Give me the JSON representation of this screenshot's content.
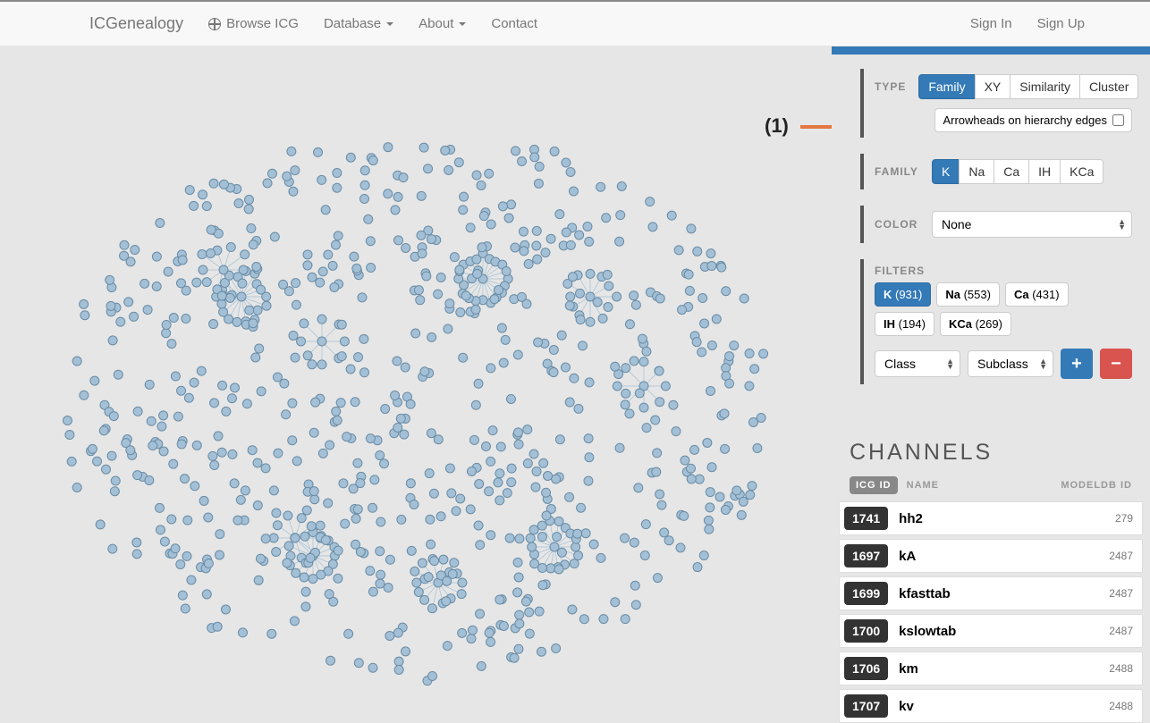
{
  "nav": {
    "brand": "ICGenealogy",
    "browse": "Browse ICG",
    "database": "Database",
    "about": "About",
    "contact": "Contact",
    "signin": "Sign In",
    "signup": "Sign Up"
  },
  "help_glyph": "?",
  "annotation": {
    "label": "(1)"
  },
  "sidebar": {
    "type": {
      "label": "TYPE",
      "options": {
        "family": "Family",
        "xy": "XY",
        "similarity": "Similarity",
        "cluster": "Cluster"
      },
      "arrowheads_label": "Arrowheads on hierarchy edges"
    },
    "family": {
      "label": "FAMILY",
      "options": {
        "k": "K",
        "na": "Na",
        "ca": "Ca",
        "ih": "IH",
        "kca": "KCa"
      }
    },
    "color": {
      "label": "COLOR",
      "value": "None"
    },
    "filters": {
      "label": "FILTERS",
      "tags": [
        {
          "name": "K",
          "count": "(931)",
          "active": true
        },
        {
          "name": "Na",
          "count": "(553)",
          "active": false
        },
        {
          "name": "Ca",
          "count": "(431)",
          "active": false
        },
        {
          "name": "IH",
          "count": "(194)",
          "active": false
        },
        {
          "name": "KCa",
          "count": "(269)",
          "active": false
        }
      ],
      "class_select": "Class",
      "subclass_select": "Subclass",
      "plus": "+",
      "minus": "−"
    },
    "channels": {
      "header": "CHANNELS",
      "col_icg": "ICG ID",
      "col_name": "NAME",
      "col_mdb": "MODELDB ID",
      "rows": [
        {
          "id": "1741",
          "name": "hh2",
          "mdb": "279"
        },
        {
          "id": "1697",
          "name": "kA",
          "mdb": "2487"
        },
        {
          "id": "1699",
          "name": "kfasttab",
          "mdb": "2487"
        },
        {
          "id": "1700",
          "name": "kslowtab",
          "mdb": "2487"
        },
        {
          "id": "1706",
          "name": "km",
          "mdb": "2488"
        },
        {
          "id": "1707",
          "name": "kv",
          "mdb": "2488"
        }
      ]
    }
  }
}
